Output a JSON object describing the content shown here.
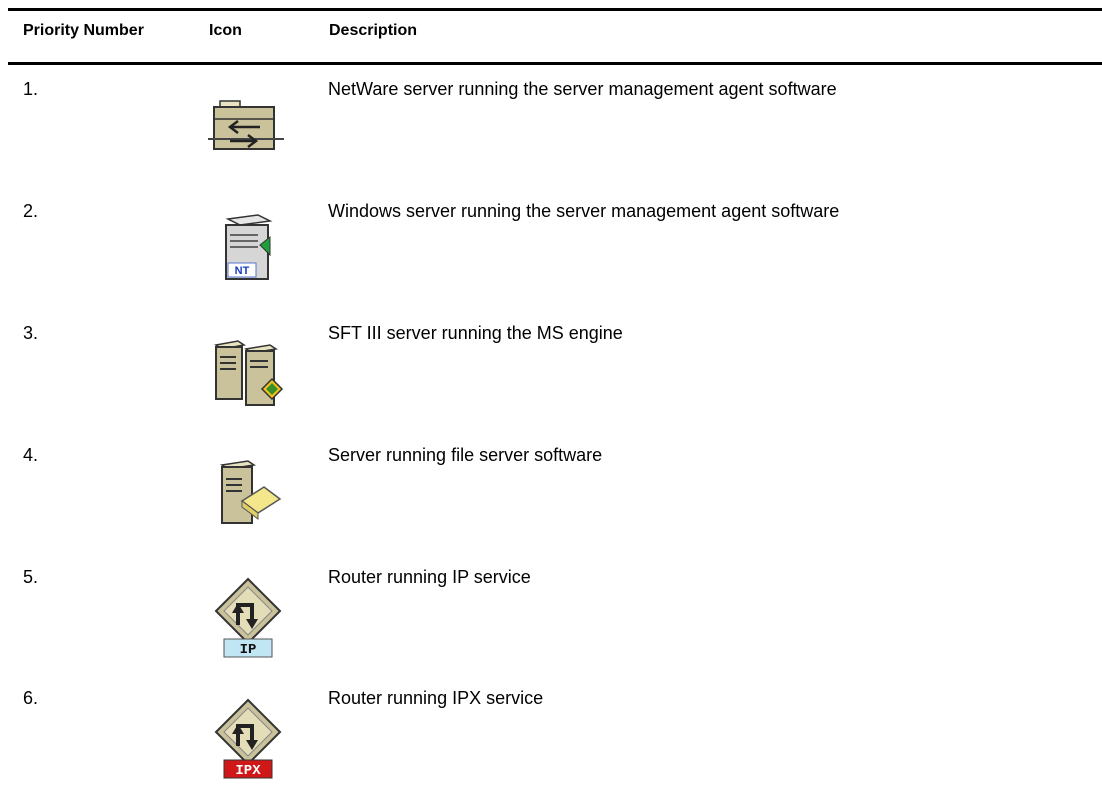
{
  "table": {
    "headers": {
      "priority": "Priority Number",
      "icon": "Icon",
      "description": "Description"
    },
    "rows": [
      {
        "priority": "1.",
        "icon": "netware-server-icon",
        "description": "NetWare server running the server management agent software"
      },
      {
        "priority": "2.",
        "icon": "windows-nt-server-icon",
        "description": "Windows server running the server management agent software"
      },
      {
        "priority": "3.",
        "icon": "sft-iii-server-icon",
        "description": "SFT III server running the MS engine"
      },
      {
        "priority": "4.",
        "icon": "file-server-icon",
        "description": "Server running file server software"
      },
      {
        "priority": "5.",
        "icon": "ip-router-icon",
        "description": "Router running IP service"
      },
      {
        "priority": "6.",
        "icon": "ipx-router-icon",
        "description": "Router running IPX service"
      }
    ]
  },
  "icon_labels": {
    "nt": "NT",
    "ip": "IP",
    "ipx": "IPX"
  },
  "colors": {
    "rule": "#000000",
    "server_body": "#c9c29a",
    "ip_label_bg": "#bfe6f2",
    "ipx_label_bg": "#d01818"
  }
}
